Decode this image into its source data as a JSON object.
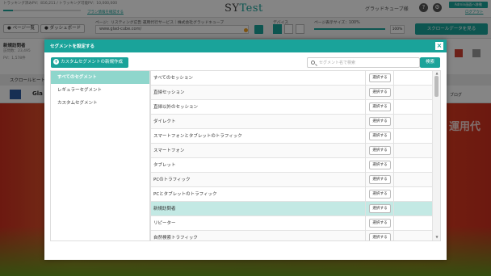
{
  "topbar": {
    "tracking_line1": "トラッキング済みPV：816,211 / トラッキング可能PV：10,000,000",
    "tracking_percent": 0.12,
    "upgrade_link": "プラン情報を確認する",
    "logo_prefix": "SY",
    "logo_suffix": "Test",
    "company": "グラッドキューブ様",
    "admin_button": "Admin画面へ移動",
    "logout": "ログアウト"
  },
  "toolbar": {
    "pages_button": "ページ一覧",
    "dashboard_button": "ダッシュボード",
    "page_label": "ページ：リスティング広告 運用代行サービス｜株式会社グラッドキューブ",
    "url": "www.glad-cube.com/",
    "device_label": "デバイス",
    "width_label": "ページ表示サイズ：100%",
    "width_value": "100%",
    "width_min": "25%",
    "scroll_data_button": "スクロールデータを見る"
  },
  "left_panel": {
    "title": "新規訪問者",
    "subtitle": "訪問数：23,495",
    "line2": "PV：1,578件"
  },
  "scroll_row_label": "スクロールヒートマップ",
  "site": {
    "logo_text": "Gla",
    "nav_right": "ブログ",
    "banner_text": "運用代"
  },
  "modal": {
    "title": "セグメントを設定する",
    "create_button": "カスタムセグメントの新規作成",
    "search_placeholder": "セグメント名で検索",
    "search_button": "検索",
    "categories": [
      {
        "label": "すべてのセグメント",
        "active": true
      },
      {
        "label": "レギュラーセグメント",
        "active": false
      },
      {
        "label": "カスタムセグメント",
        "active": false
      }
    ],
    "select_label": "選択する",
    "segments": [
      {
        "name": "すべてのセッション"
      },
      {
        "name": "直帰セッション"
      },
      {
        "name": "直帰以外のセッション"
      },
      {
        "name": "ダイレクト"
      },
      {
        "name": "スマートフォンとタブレットのトラフィック"
      },
      {
        "name": "スマートフォン"
      },
      {
        "name": "タブレット"
      },
      {
        "name": "PCのトラフィック"
      },
      {
        "name": "PCとタブレットのトラフィック"
      },
      {
        "name": "新規訪問者",
        "active": true
      },
      {
        "name": "リピーター"
      },
      {
        "name": "自然検索トラフィック"
      }
    ]
  },
  "colors": {
    "accent": "#1aa39a",
    "active_row": "#c3e9e4",
    "active_category": "#8fd6cc"
  },
  "icons": [
    "plus-icon",
    "search-icon",
    "close-icon",
    "help-icon",
    "gear-icon",
    "list-icon",
    "dashboard-icon"
  ]
}
